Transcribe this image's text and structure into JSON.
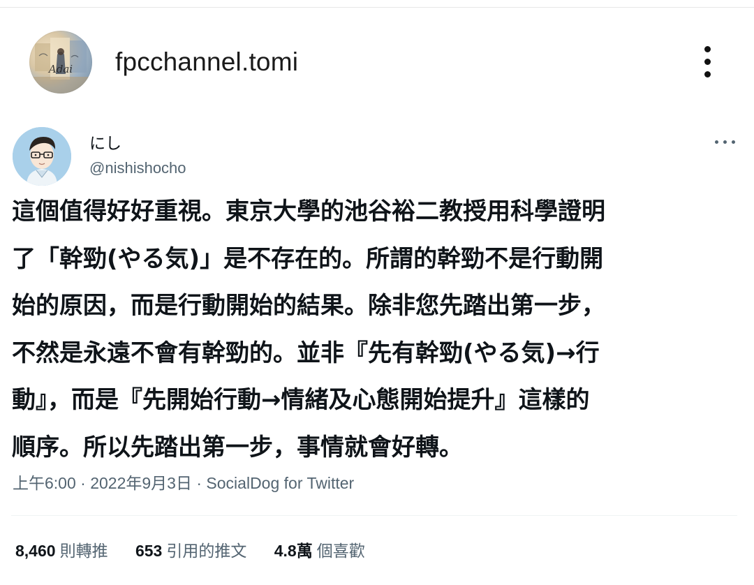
{
  "post": {
    "channel_name": "fpcchannel.tomi",
    "avatar_signature": "Adai"
  },
  "tweet": {
    "author_name": "にし",
    "author_handle": "@nishishocho",
    "text": "這個值得好好重視。東京大學的池谷裕二教授用科學證明\n了「幹勁(やる気)」是不存在的。所謂的幹勁不是行動開\n始的原因，而是行動開始的結果。除非您先踏出第一步，\n不然是永遠不會有幹勁的。並非『先有幹勁(やる気)→行\n動』，而是『先開始行動→情緒及心態開始提升』這樣的\n順序。所以先踏出第一步，事情就會好轉。",
    "time": "上午6:00",
    "separator": " · ",
    "date": "2022年9月3日",
    "source": "SocialDog for Twitter"
  },
  "stats": {
    "retweets_count": "8,460",
    "retweets_label": "則轉推",
    "quotes_count": "653",
    "quotes_label": "引用的推文",
    "likes_count": "4.8萬",
    "likes_label": "個喜歡"
  },
  "icons": {
    "post_menu": "kebab-vertical-icon",
    "tweet_menu": "more-horizontal-icon"
  }
}
